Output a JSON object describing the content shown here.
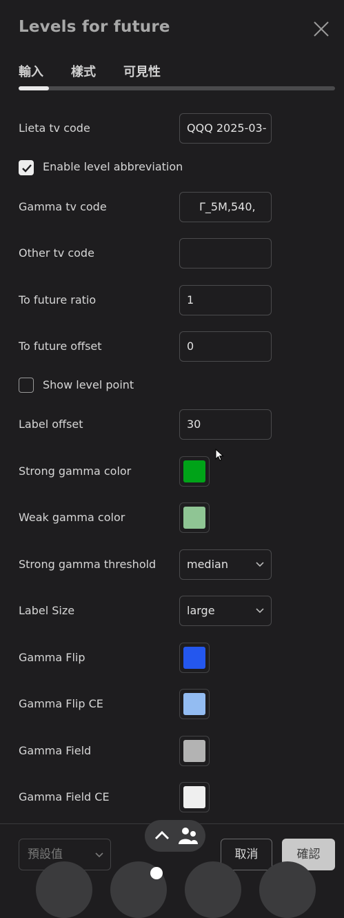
{
  "dialog": {
    "title": "Levels for future",
    "tabs": [
      {
        "label": "輸入",
        "active": true
      },
      {
        "label": "樣式",
        "active": false
      },
      {
        "label": "可見性",
        "active": false
      }
    ]
  },
  "inputs": {
    "lieta_tv_code": {
      "label": "Lieta tv code",
      "value": "QQQ 2025-03-"
    },
    "enable_abbreviation": {
      "label": "Enable level abbreviation",
      "checked": true
    },
    "gamma_tv_code": {
      "label": "Gamma tv code",
      "value": "Γ_5M,540,"
    },
    "other_tv_code": {
      "label": "Other tv code",
      "value": ""
    },
    "to_future_ratio": {
      "label": "To future ratio",
      "value": "1"
    },
    "to_future_offset": {
      "label": "To future offset",
      "value": "0"
    },
    "show_level_point": {
      "label": "Show level point",
      "checked": false
    },
    "label_offset": {
      "label": "Label offset",
      "value": "30"
    },
    "strong_gamma_color": {
      "label": "Strong gamma color",
      "color": "#00a318"
    },
    "weak_gamma_color": {
      "label": "Weak gamma color",
      "color": "#8fc594"
    },
    "strong_gamma_threshold": {
      "label": "Strong gamma threshold",
      "value": "median"
    },
    "label_size": {
      "label": "Label Size",
      "value": "large"
    },
    "gamma_flip": {
      "label": "Gamma Flip",
      "color": "#2457ee"
    },
    "gamma_flip_ce": {
      "label": "Gamma Flip CE",
      "color": "#93bcf2"
    },
    "gamma_field": {
      "label": "Gamma Field",
      "color": "#b3b3b3"
    },
    "gamma_field_ce": {
      "label": "Gamma Field CE",
      "color": "#efefef"
    }
  },
  "footer": {
    "preset_label": "預設值",
    "cancel_label": "取消",
    "ok_label": "確認"
  },
  "icons": {
    "close": "close-icon",
    "checkbox_check": "check-icon",
    "dropdown": "chevron-down-icon",
    "float_up": "chevron-up-icon",
    "float_people": "people-icon"
  }
}
